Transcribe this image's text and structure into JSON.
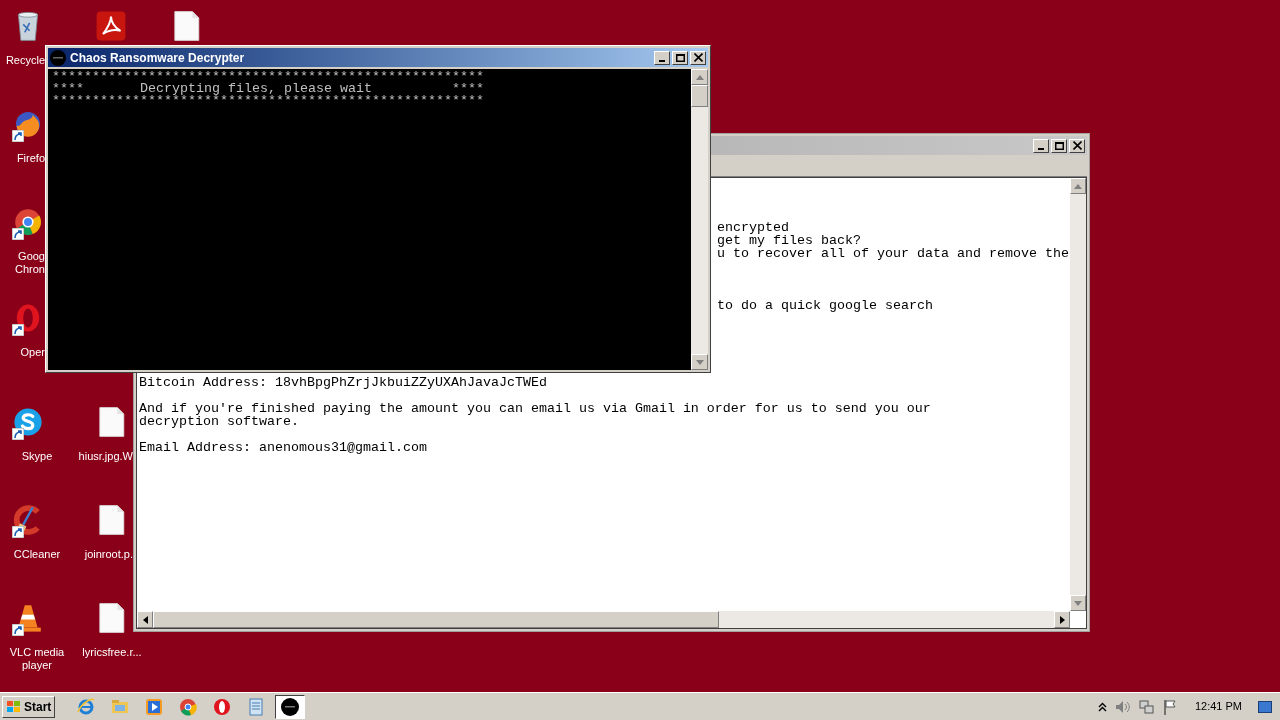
{
  "desktop": {
    "icons": [
      {
        "kind": "recycle",
        "label_lines": [
          "Recycle"
        ]
      },
      {
        "kind": "firefox",
        "label_lines": [
          "Firefo"
        ]
      },
      {
        "kind": "chrome",
        "label_lines": [
          "Goog",
          "Chron"
        ]
      },
      {
        "kind": "opera",
        "label_lines": [
          "Oper"
        ]
      },
      {
        "kind": "skype",
        "label_lines": [
          "Skype"
        ]
      },
      {
        "kind": "ccleaner",
        "label_lines": [
          "CCleaner"
        ]
      },
      {
        "kind": "vlc",
        "label_lines": [
          "VLC media",
          "player"
        ]
      },
      {
        "kind": "acrobat"
      },
      {
        "kind": "file",
        "label_lines": [
          "hiusr.jpg.W"
        ]
      },
      {
        "kind": "file",
        "label_lines": [
          "joinroot.p."
        ]
      },
      {
        "kind": "file",
        "label_lines": [
          "lyricsfree.r..."
        ]
      },
      {
        "kind": "file"
      }
    ]
  },
  "notepad": {
    "right_fragments": [
      "encrypted",
      "get my files back?",
      "u to recover all of your data and remove the",
      "to do a quick google search"
    ],
    "lines": [
      "Bitcoin Address: 18vhBpgPhZrjJkbuiZZyUXAhJavaJcTWEd",
      "And if you're finished paying the amount you can email us via Gmail in order for us to send you our",
      "decryption software.",
      "Email Address: anenomous31@gmail.com"
    ]
  },
  "console": {
    "title": "Chaos Ransomware Decrypter",
    "lines": [
      "******************************************************",
      "****       Decrypting files, please wait          ****",
      "******************************************************"
    ]
  },
  "taskbar": {
    "start": "Start",
    "apps": [
      {
        "kind": "ie",
        "selected": false
      },
      {
        "kind": "explorer",
        "selected": false
      },
      {
        "kind": "media",
        "selected": false
      },
      {
        "kind": "chrome",
        "selected": false
      },
      {
        "kind": "opera",
        "selected": false
      },
      {
        "kind": "notepad",
        "selected": false
      },
      {
        "kind": "chaos",
        "selected": true
      }
    ],
    "clock": "12:41 PM"
  }
}
